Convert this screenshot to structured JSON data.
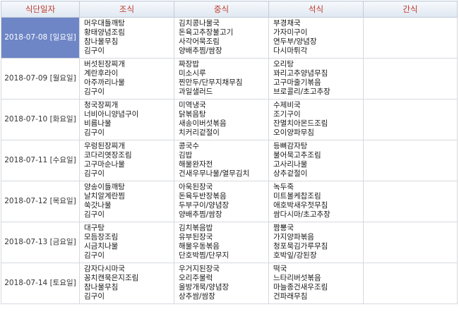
{
  "headers": [
    "식단일자",
    "조식",
    "중식",
    "석식",
    "간식"
  ],
  "rows": [
    {
      "date": "2018-07-08 [일요일]",
      "breakfast": [
        "머우대들깨탕",
        "황태양념조림",
        "참나물무침",
        "김구이"
      ],
      "lunch": [
        "김치콩나물국",
        "돈육고추장불고기",
        "사각어묵조림",
        "양배추찜/쌈장"
      ],
      "dinner": [
        "부경채국",
        "가자미구이",
        "연두부/양념장",
        "다시마튀각"
      ],
      "snack": []
    },
    {
      "date": "2018-07-09 [월요일]",
      "breakfast": [
        "버섯된장찌개",
        "계란후라이",
        "아주까리나물",
        "김구이"
      ],
      "lunch": [
        "짜장밥",
        "미소시루",
        "찐만두/단무지채무침",
        "과일샐러드"
      ],
      "dinner": [
        "오리탕",
        "꽈리고추양념무침",
        "고구마줄기볶음",
        "브로콜리/초고추장"
      ],
      "snack": []
    },
    {
      "date": "2018-07-10 [화요일]",
      "breakfast": [
        "청국장찌개",
        "너비아니양념구이",
        "비름나물",
        "김구이"
      ],
      "lunch": [
        "미역냉국",
        "닭볶음탕",
        "새송이버섯볶음",
        "치커리겉절이"
      ],
      "dinner": [
        "수제비국",
        "조기구이",
        "잔멸치아몬드조림",
        "오이양파무침"
      ],
      "snack": []
    },
    {
      "date": "2018-07-11 [수요일]",
      "breakfast": [
        "우렁된장찌개",
        "코다리엿장조림",
        "고구마순나물",
        "김구이"
      ],
      "lunch": [
        "콩국수",
        "김밥",
        "해물완자전",
        "건새우무나물/열무김치"
      ],
      "dinner": [
        "등뼈감자탕",
        "불어묵고추조림",
        "고사리나물",
        "상추겉절이"
      ],
      "snack": []
    },
    {
      "date": "2018-07-12 [목요일]",
      "breakfast": [
        "양송이들깨탕",
        "날치알계란찜",
        "쑥갓나물",
        "김구이"
      ],
      "lunch": [
        "아욱된장국",
        "돈육두반장볶음",
        "두부구이/양념장",
        "양배추찜/쌈장"
      ],
      "dinner": [
        "녹두죽",
        "미트볼케찹조림",
        "애호박새우젓무침",
        "쌈다시마/초고추장"
      ],
      "snack": []
    },
    {
      "date": "2018-07-13 [금요일]",
      "breakfast": [
        "대구탕",
        "모듬장조림",
        "시금치나물",
        "김구이"
      ],
      "lunch": [
        "김치볶음밥",
        "유부된장국",
        "해물우동볶음",
        "단호박찜/단무지"
      ],
      "dinner": [
        "짬뽕국",
        "가지양파볶음",
        "청포묵김가루무침",
        "호박잎/강된장"
      ],
      "snack": []
    },
    {
      "date": "2018-07-14 [토요일]",
      "breakfast": [
        "감자다시마국",
        "꽁치캔묵은지조림",
        "참나물무침",
        "김구이"
      ],
      "lunch": [
        "우거지된장국",
        "오리주물럭",
        "올방개묵/양념장",
        "상추쌈/쌈장"
      ],
      "dinner": [
        "떡국",
        "느타리버섯볶음",
        "마늘종건새우조림",
        "건파래무침"
      ],
      "snack": []
    }
  ]
}
